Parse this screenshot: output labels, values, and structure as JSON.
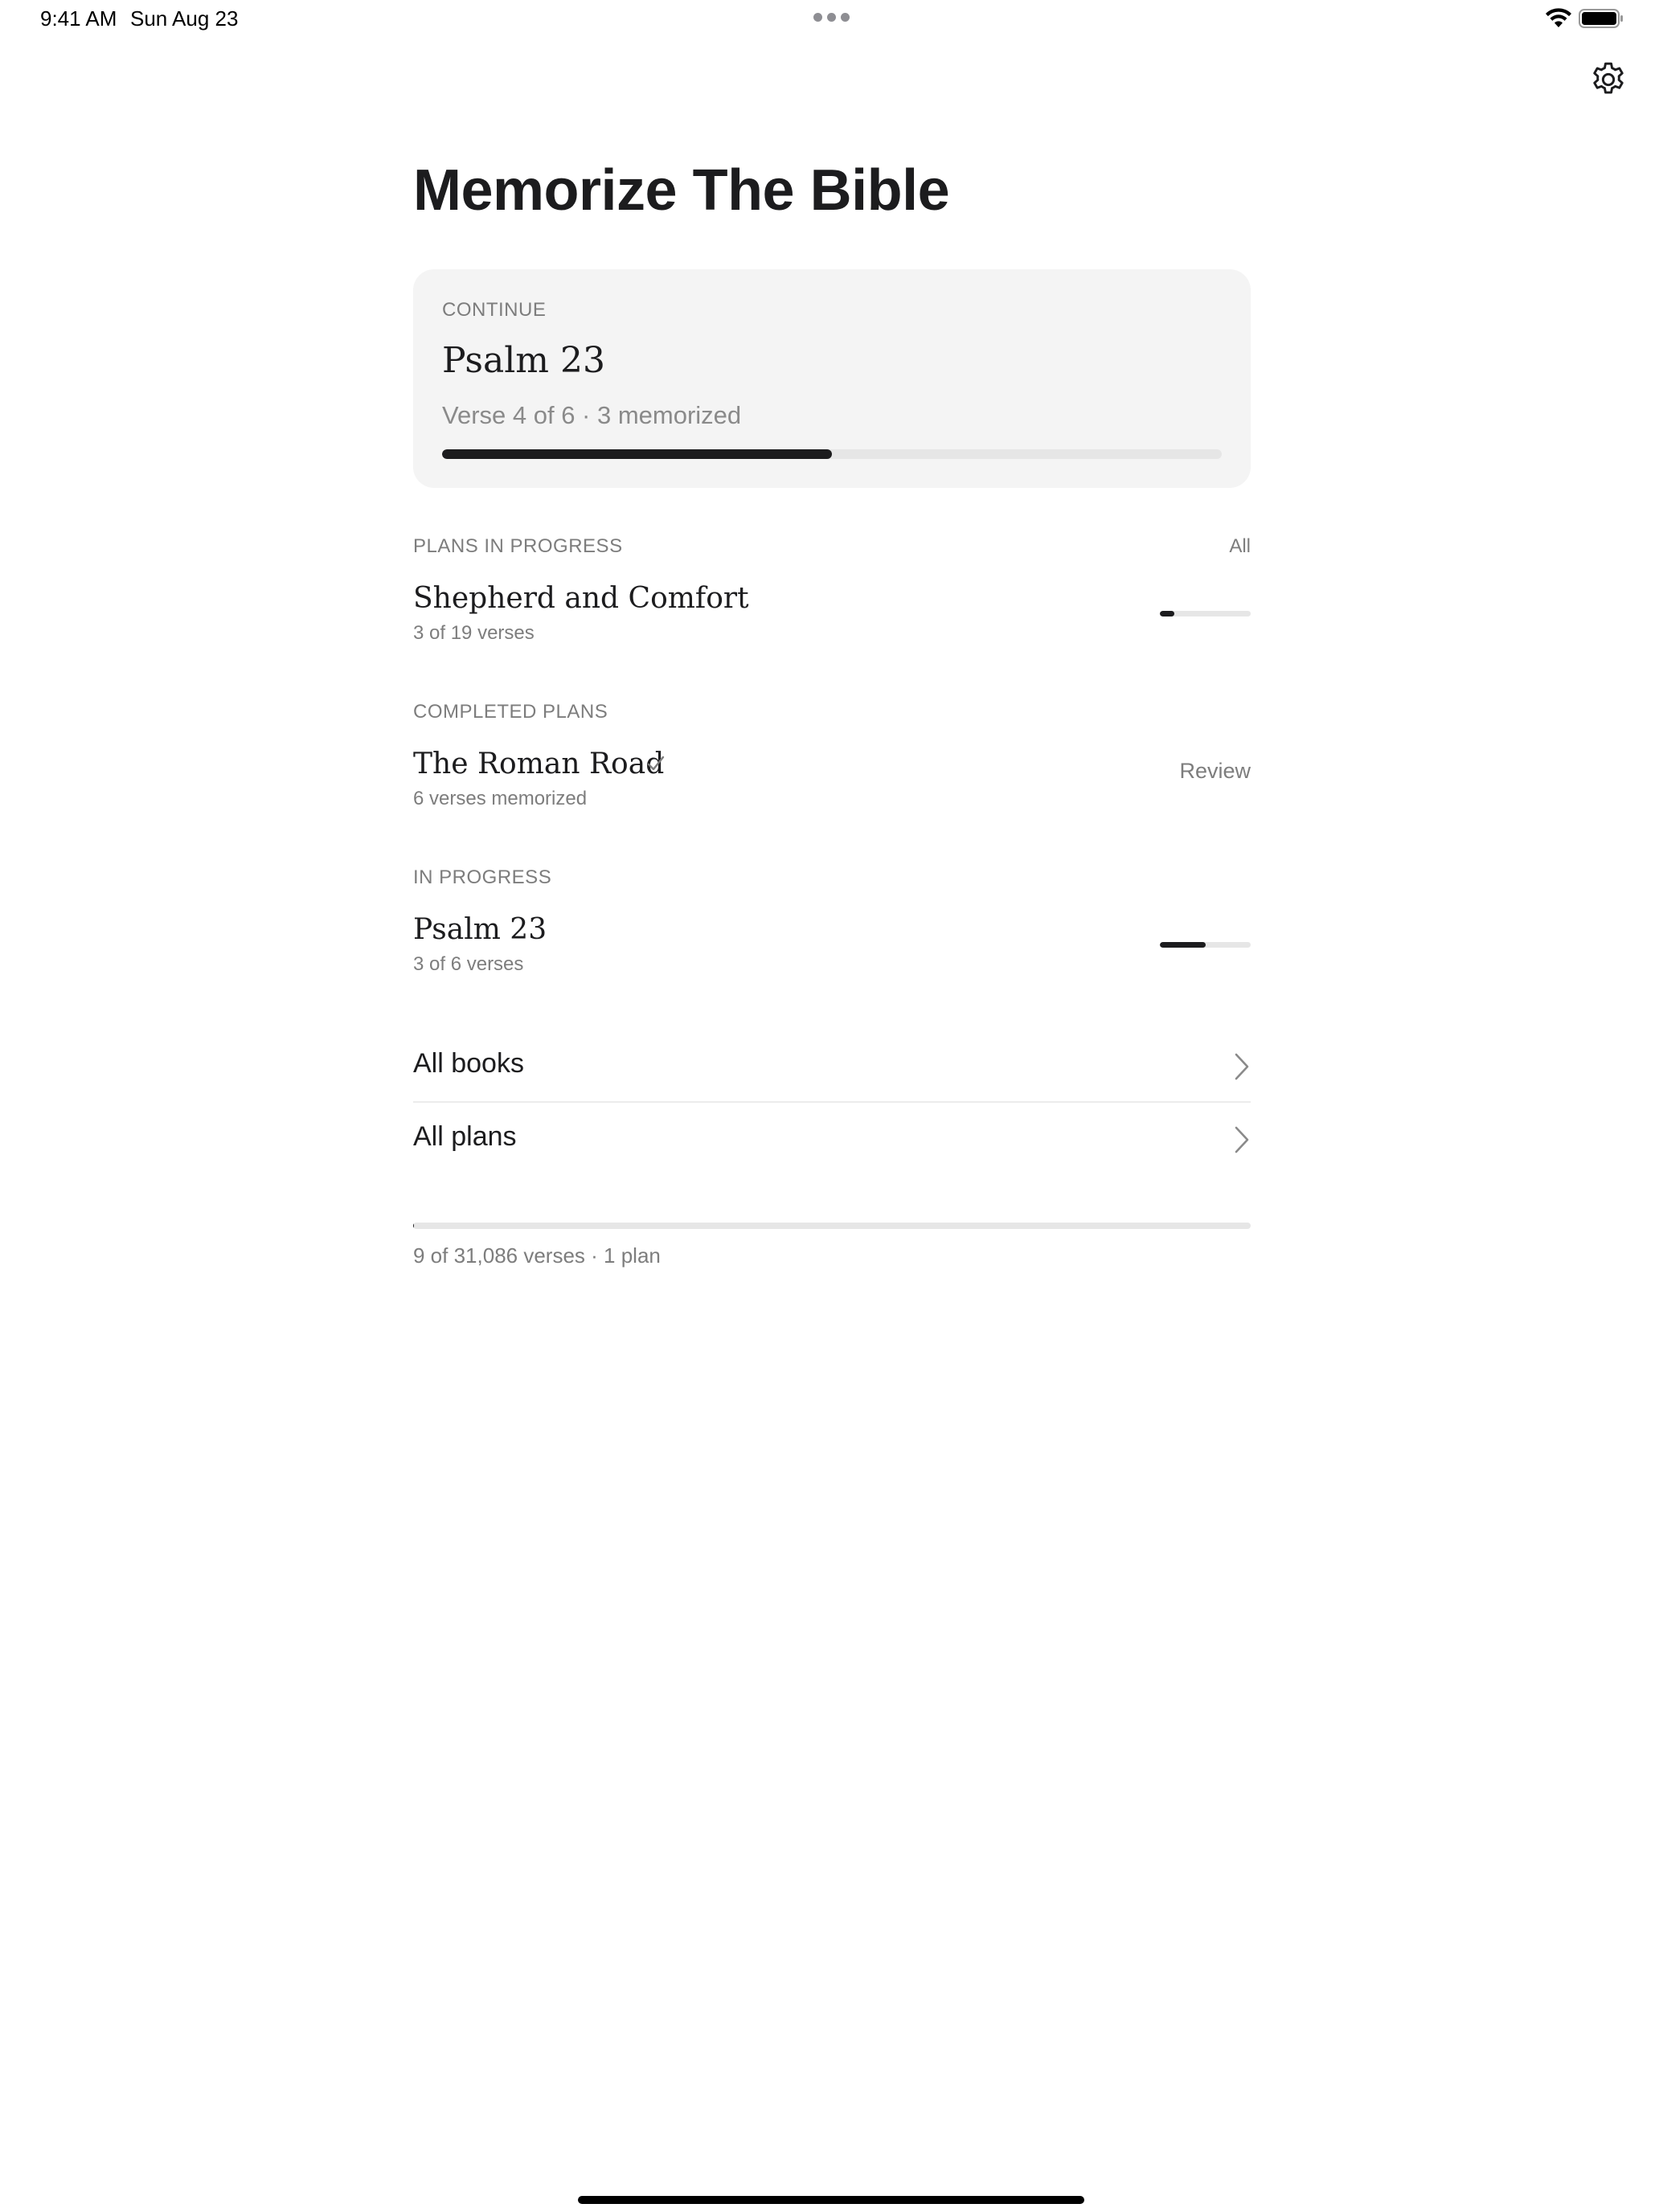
{
  "status_bar": {
    "time": "9:41 AM",
    "date": "Sun Aug 23"
  },
  "page": {
    "title": "Memorize The Bible"
  },
  "continue_card": {
    "eyebrow": "CONTINUE",
    "title": "Psalm 23",
    "subtitle": "Verse 4 of 6 · 3 memorized",
    "progress": 0.5
  },
  "plans_in_progress": {
    "header": "PLANS IN PROGRESS",
    "all_label": "All",
    "items": [
      {
        "title": "Shepherd and Comfort",
        "subtitle": "3 of 19 verses",
        "progress": 0.158
      }
    ]
  },
  "completed_plans": {
    "header": "COMPLETED PLANS",
    "items": [
      {
        "title": "The Roman Road",
        "subtitle": "6 verses memorized",
        "action_label": "Review"
      }
    ]
  },
  "in_progress": {
    "header": "IN PROGRESS",
    "items": [
      {
        "title": "Psalm 23",
        "subtitle": "3 of 6 verses",
        "progress": 0.5
      }
    ]
  },
  "navigation": {
    "all_books": "All books",
    "all_plans": "All plans"
  },
  "footer": {
    "summary": "9 of 31,086 verses · 1 plan",
    "progress": 0.0003
  },
  "icons": {
    "settings": "gear-icon",
    "wifi": "wifi-icon",
    "battery": "battery-icon",
    "check": "checkmark-icon",
    "chevron": "chevron-right-icon"
  },
  "colors": {
    "accent": "#1c1c1e",
    "card_background": "#f4f4f4",
    "secondary_text": "#7d7d7d",
    "track": "#e6e6e6"
  }
}
